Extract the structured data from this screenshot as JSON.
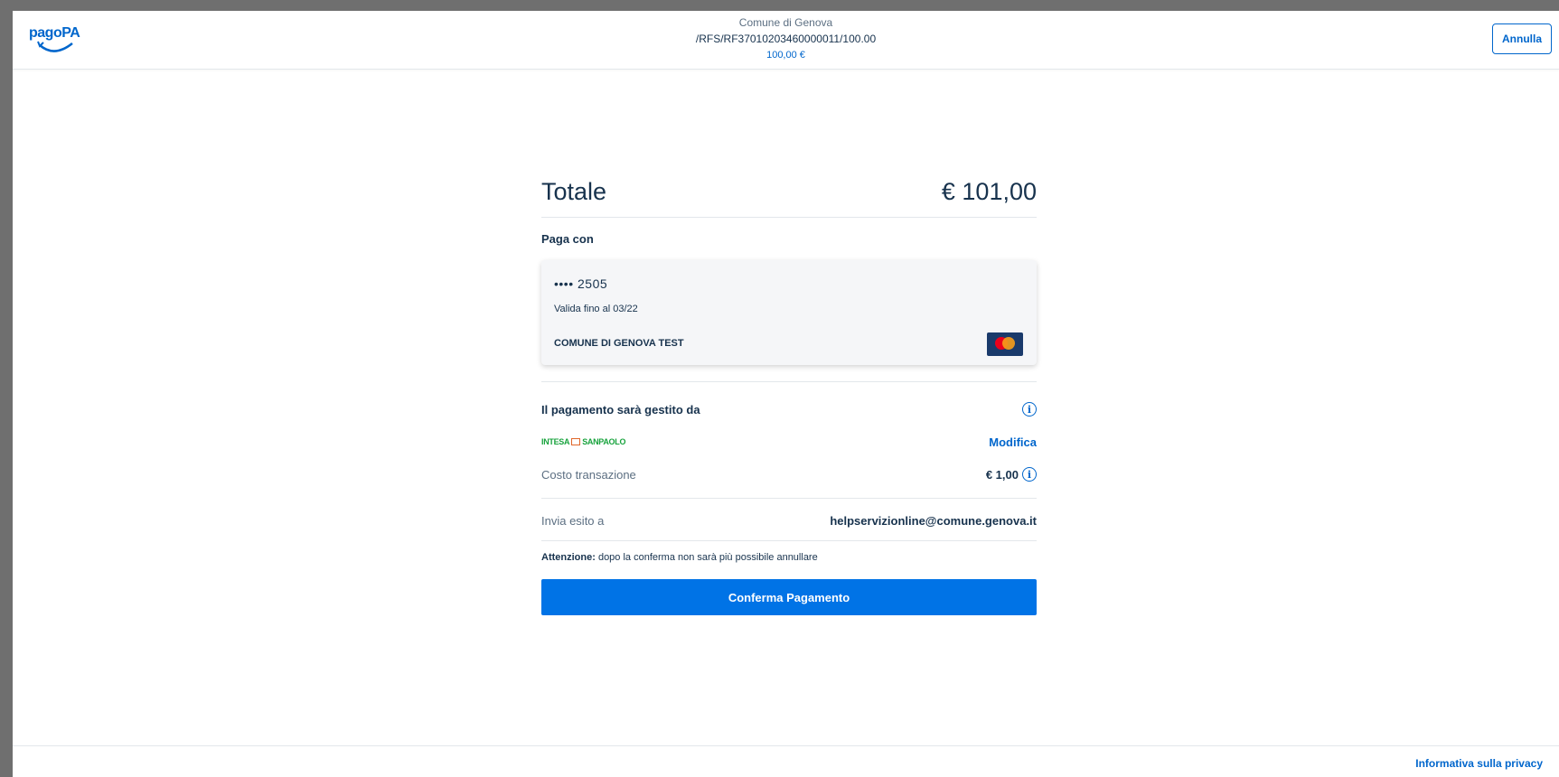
{
  "header": {
    "logo_text": "pagoPA",
    "organization": "Comune di Genova",
    "reference": "/RFS/RF37010203460000011/100.00",
    "amount": "100,00 €",
    "cancel_label": "Annulla"
  },
  "summary": {
    "total_label": "Totale",
    "total_value": "€ 101,00",
    "pay_with_label": "Paga con"
  },
  "card": {
    "number": "•••• 2505",
    "expiry": "Valida fino al 03/22",
    "holder": "COMUNE DI GENOVA TEST",
    "brand_icon": "mastercard-icon"
  },
  "psp": {
    "managed_by_label": "Il pagamento sarà gestito da",
    "name_left": "INTESA",
    "name_right": "SANPAOLO",
    "modify_label": "Modifica",
    "cost_label": "Costo transazione",
    "cost_value": "€ 1,00"
  },
  "email": {
    "label": "Invia esito a",
    "value": "helpservizionline@comune.genova.it"
  },
  "warning": {
    "bold": "Attenzione:",
    "text": " dopo la conferma non sarà più possibile annullare"
  },
  "actions": {
    "confirm_label": "Conferma Pagamento"
  },
  "footer": {
    "privacy_label": "Informativa sulla privacy"
  },
  "colors": {
    "primary": "#0066cc",
    "button": "#0073e6",
    "text": "#17324d",
    "muted": "#5c6f82"
  }
}
